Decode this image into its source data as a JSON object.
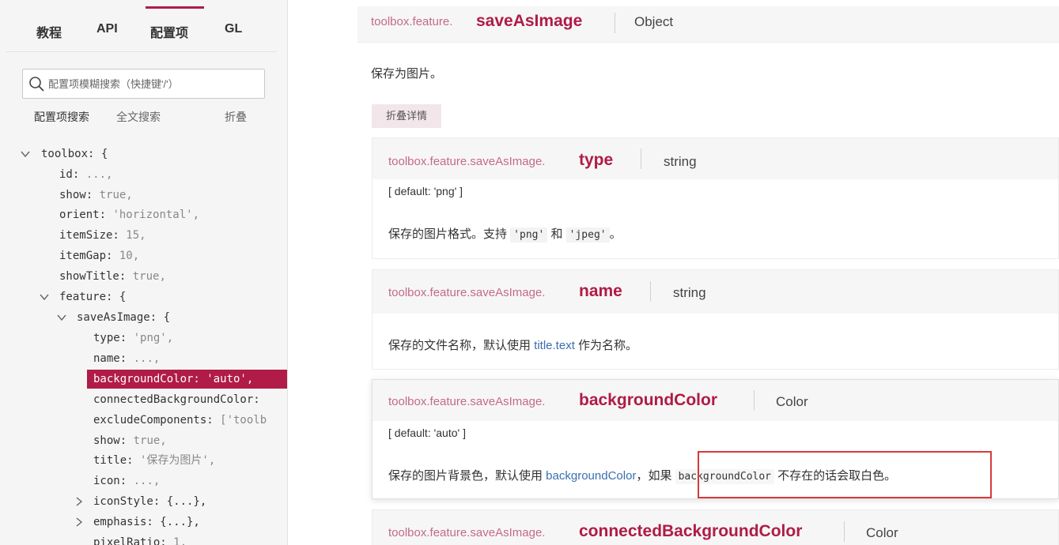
{
  "nav": {
    "tabs": [
      "教程",
      "API",
      "配置项",
      "GL"
    ],
    "active_tab": "配置项"
  },
  "search": {
    "placeholder": "配置项模糊搜索（快捷键'/'）",
    "modes": [
      "配置项搜索",
      "全文搜索"
    ],
    "fold": "折叠"
  },
  "tree": [
    {
      "key": "toolbox: {",
      "val": "",
      "expanded": true
    },
    {
      "key": "id:",
      "val": " ...,"
    },
    {
      "key": "show:",
      "val": " true,"
    },
    {
      "key": "orient:",
      "val": " 'horizontal',"
    },
    {
      "key": "itemSize:",
      "val": " 15,"
    },
    {
      "key": "itemGap:",
      "val": " 10,"
    },
    {
      "key": "showTitle:",
      "val": " true,"
    },
    {
      "key": "feature: {",
      "val": "",
      "expanded": true
    },
    {
      "key": "saveAsImage: {",
      "val": "",
      "expanded": true
    },
    {
      "key": "type:",
      "val": " 'png',"
    },
    {
      "key": "name:",
      "val": " ...,"
    },
    {
      "key": "backgroundColor:",
      "val": " 'auto',",
      "selected": true
    },
    {
      "key": "connectedBackgroundColor:",
      "val": ""
    },
    {
      "key": "excludeComponents:",
      "val": " ['toolb"
    },
    {
      "key": "show:",
      "val": " true,"
    },
    {
      "key": "title:",
      "val": " '保存为图片',"
    },
    {
      "key": "icon:",
      "val": " ...,"
    },
    {
      "key": "iconStyle: {...},",
      "val": "",
      "collapsed": true
    },
    {
      "key": "emphasis: {...},",
      "val": "",
      "collapsed": true
    },
    {
      "key": "pixelRatio:",
      "val": " 1,"
    }
  ],
  "main": {
    "header": {
      "path": "toolbox.feature.",
      "prop": "saveAsImage",
      "type": "Object"
    },
    "description": "保存为图片。",
    "fold_button": "折叠详情",
    "cards": [
      {
        "path": "toolbox.feature.saveAsImage.",
        "prop": "type",
        "type": "string",
        "default": "[ default: 'png' ]",
        "desc_prefix": "保存的图片格式。支持 ",
        "code1": "'png'",
        "mid": " 和 ",
        "code2": "'jpeg'",
        "desc_suffix": "。"
      },
      {
        "path": "toolbox.feature.saveAsImage.",
        "prop": "name",
        "type": "string",
        "desc_prefix": "保存的文件名称，默认使用 ",
        "link": "title.text",
        "desc_suffix": " 作为名称。"
      },
      {
        "path": "toolbox.feature.saveAsImage.",
        "prop": "backgroundColor",
        "type": "Color",
        "default": "[ default: 'auto' ]",
        "desc_prefix": "保存的图片背景色，默认使用 ",
        "link": "backgroundColor",
        "comma": "，",
        "hl_prefix": "如果 ",
        "hl_code": "backgroundColor",
        "hl_suffix": " 不存在的话会取白色。"
      },
      {
        "path": "toolbox.feature.saveAsImage.",
        "prop": "connectedBackgroundColor",
        "type": "Color"
      }
    ]
  },
  "colors": {
    "accent": "#b01b47",
    "link": "#3a6fb0",
    "highlight_border": "#d83a3a"
  }
}
